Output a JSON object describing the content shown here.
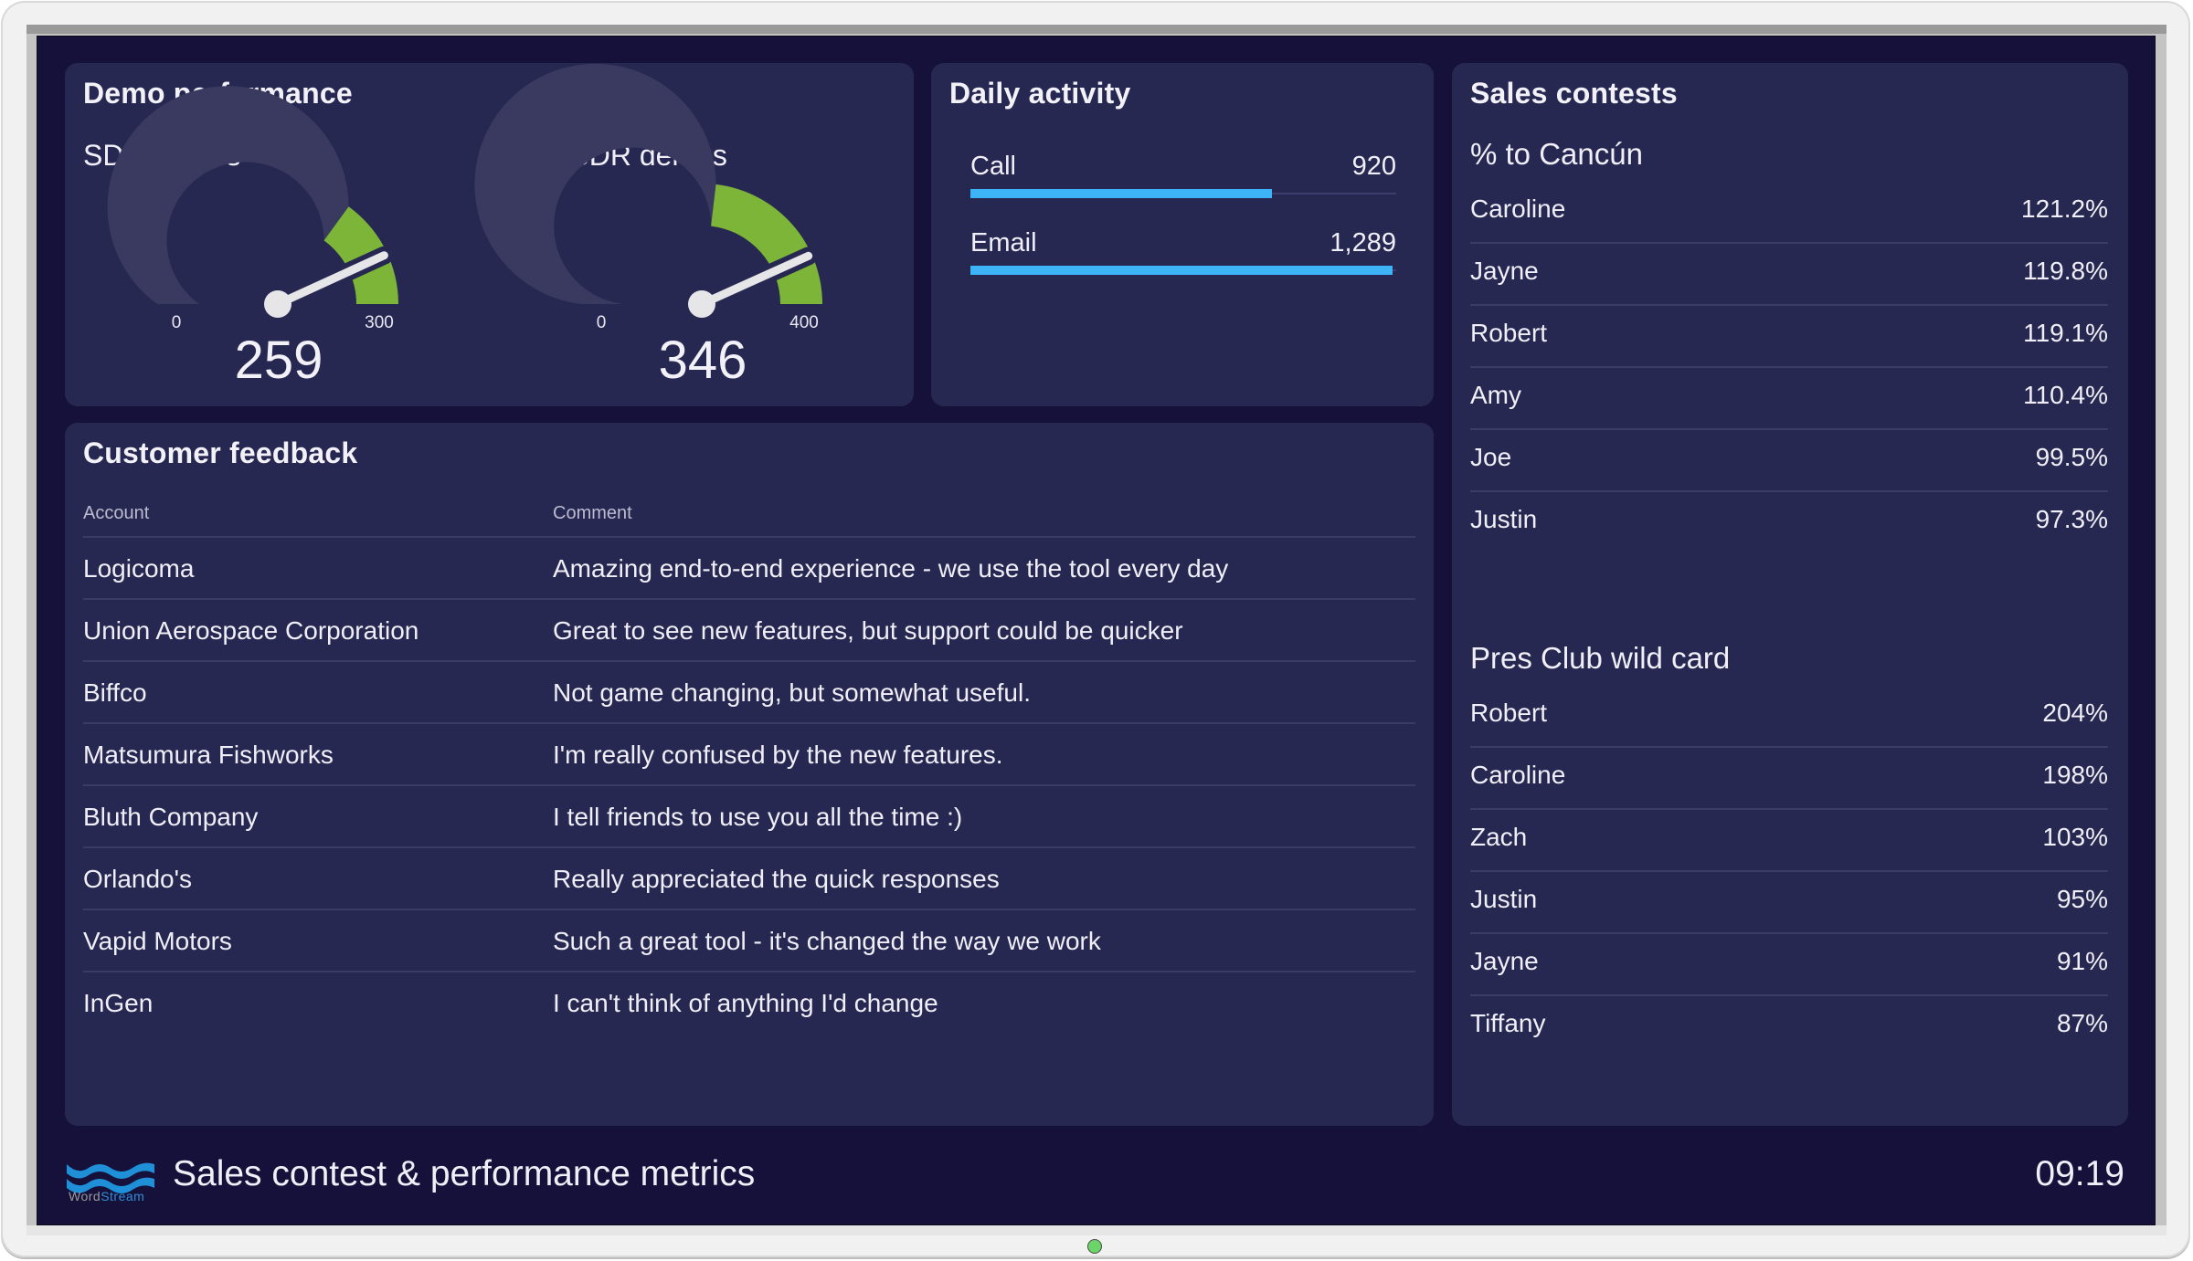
{
  "colors": {
    "screen_bg": "#15113a",
    "panel_bg": "#272852",
    "gauge_track": "#3a3a60",
    "gauge_target": "#7db538",
    "needle": "#e6e6e8",
    "bar": "#3db4f8",
    "led": "#6bd56a"
  },
  "demo_performance": {
    "title": "Demo performance",
    "gauges": [
      {
        "label": "SDR demos",
        "value": 259,
        "value_label": "259",
        "min": 0,
        "max": 300,
        "min_label": "0",
        "max_label": "300",
        "target_start": 210
      },
      {
        "label": "Non-SDR demos",
        "value": 346,
        "value_label": "346",
        "min": 0,
        "max": 400,
        "min_label": "0",
        "max_label": "400",
        "target_start": 215
      }
    ]
  },
  "daily_activity": {
    "title": "Daily activity",
    "scale_max": 1300,
    "items": [
      {
        "label": "Call",
        "value": 920,
        "value_label": "920"
      },
      {
        "label": "Email",
        "value": 1289,
        "value_label": "1,289"
      }
    ]
  },
  "sales_contests": {
    "title": "Sales contests",
    "contests": [
      {
        "title": "% to Cancún",
        "rows": [
          {
            "name": "Caroline",
            "value": "121.2%"
          },
          {
            "name": "Jayne",
            "value": "119.8%"
          },
          {
            "name": "Robert",
            "value": "119.1%"
          },
          {
            "name": "Amy",
            "value": "110.4%"
          },
          {
            "name": "Joe",
            "value": "99.5%"
          },
          {
            "name": "Justin",
            "value": "97.3%"
          }
        ]
      },
      {
        "title": "Pres Club wild card",
        "rows": [
          {
            "name": "Robert",
            "value": "204%"
          },
          {
            "name": "Caroline",
            "value": "198%"
          },
          {
            "name": "Zach",
            "value": "103%"
          },
          {
            "name": "Justin",
            "value": "95%"
          },
          {
            "name": "Jayne",
            "value": "91%"
          },
          {
            "name": "Tiffany",
            "value": "87%"
          }
        ]
      }
    ]
  },
  "customer_feedback": {
    "title": "Customer feedback",
    "columns": [
      "Account",
      "Comment"
    ],
    "rows": [
      {
        "account": "Logicoma",
        "comment": "Amazing end-to-end experience - we use the tool every day"
      },
      {
        "account": "Union Aerospace Corporation",
        "comment": "Great to see new features, but support could be quicker"
      },
      {
        "account": "Biffco",
        "comment": "Not game changing, but somewhat useful."
      },
      {
        "account": "Matsumura Fishworks",
        "comment": "I'm really confused by the new features."
      },
      {
        "account": "Bluth Company",
        "comment": "I tell friends to use you all the time :)"
      },
      {
        "account": "Orlando's",
        "comment": "Really appreciated the quick responses"
      },
      {
        "account": "Vapid Motors",
        "comment": "Such a great tool - it's changed the way we work"
      },
      {
        "account": "InGen",
        "comment": "I can't think of anything I'd change"
      }
    ]
  },
  "footer": {
    "logo_icon": "wordstream-waves-icon",
    "logo_text_word": "Word",
    "logo_text_stream": "Stream",
    "title": "Sales contest & performance metrics",
    "clock": "09:19"
  }
}
